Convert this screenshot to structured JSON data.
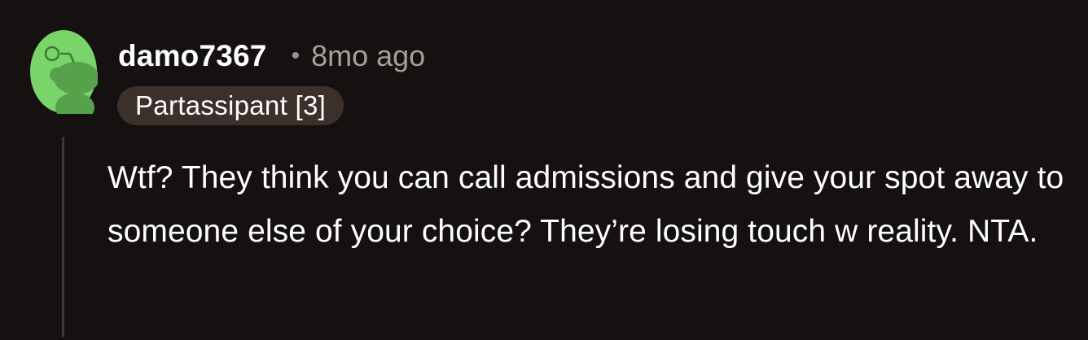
{
  "comment": {
    "author": "damo7367",
    "separator": "•",
    "timestamp": "8mo ago",
    "flair": "Partassipant [3]",
    "body": "Wtf? They think you can call admissions and give your spot away to someone else of your choice? They’re losing touch w reality. NTA.",
    "avatar_icon": "snoo-avatar-icon",
    "colors": {
      "avatar_bg": "#79d56a",
      "avatar_figure": "#55a24a",
      "flair_bg": "#3c302b",
      "thread_line": "#3b3836"
    }
  }
}
